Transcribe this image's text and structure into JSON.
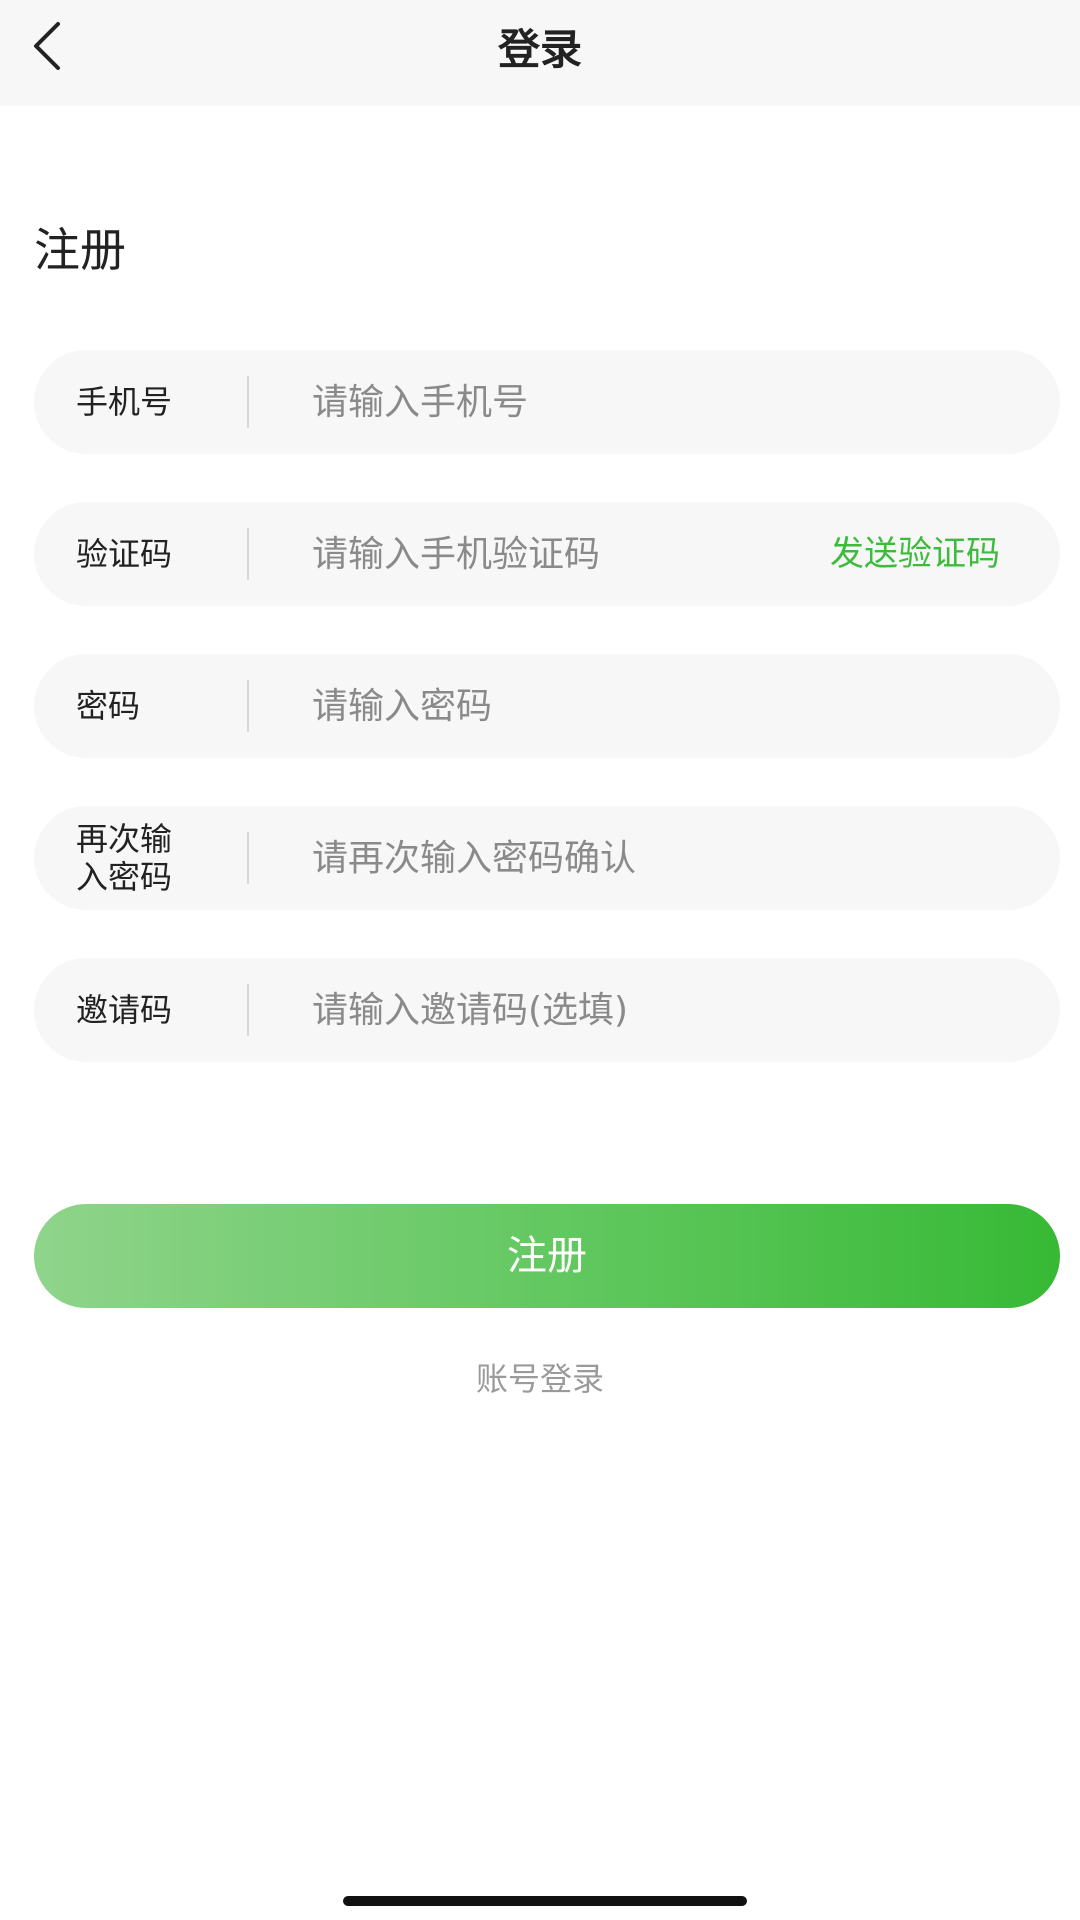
{
  "navbar": {
    "back_icon": "chevron-left-icon",
    "title": "登录"
  },
  "form": {
    "title": "注册",
    "fields": [
      {
        "label": "手机号",
        "placeholder": "请输入手机号",
        "value": ""
      },
      {
        "label": "验证码",
        "placeholder": "请输入手机验证码",
        "value": "",
        "action": "发送验证码"
      },
      {
        "label": "密码",
        "placeholder": "请输入密码",
        "value": ""
      },
      {
        "label": "再次输入密码",
        "placeholder": "请再次输入密码确认",
        "value": ""
      },
      {
        "label": "邀请码",
        "placeholder": "请输入邀请码(选填)",
        "value": ""
      }
    ],
    "submit_label": "注册",
    "switch_label": "账号登录"
  },
  "colors": {
    "accent": "#3dbb3c",
    "gradient_start": "#8fd48b",
    "gradient_end": "#37b935",
    "field_bg": "#f7f7f7"
  }
}
